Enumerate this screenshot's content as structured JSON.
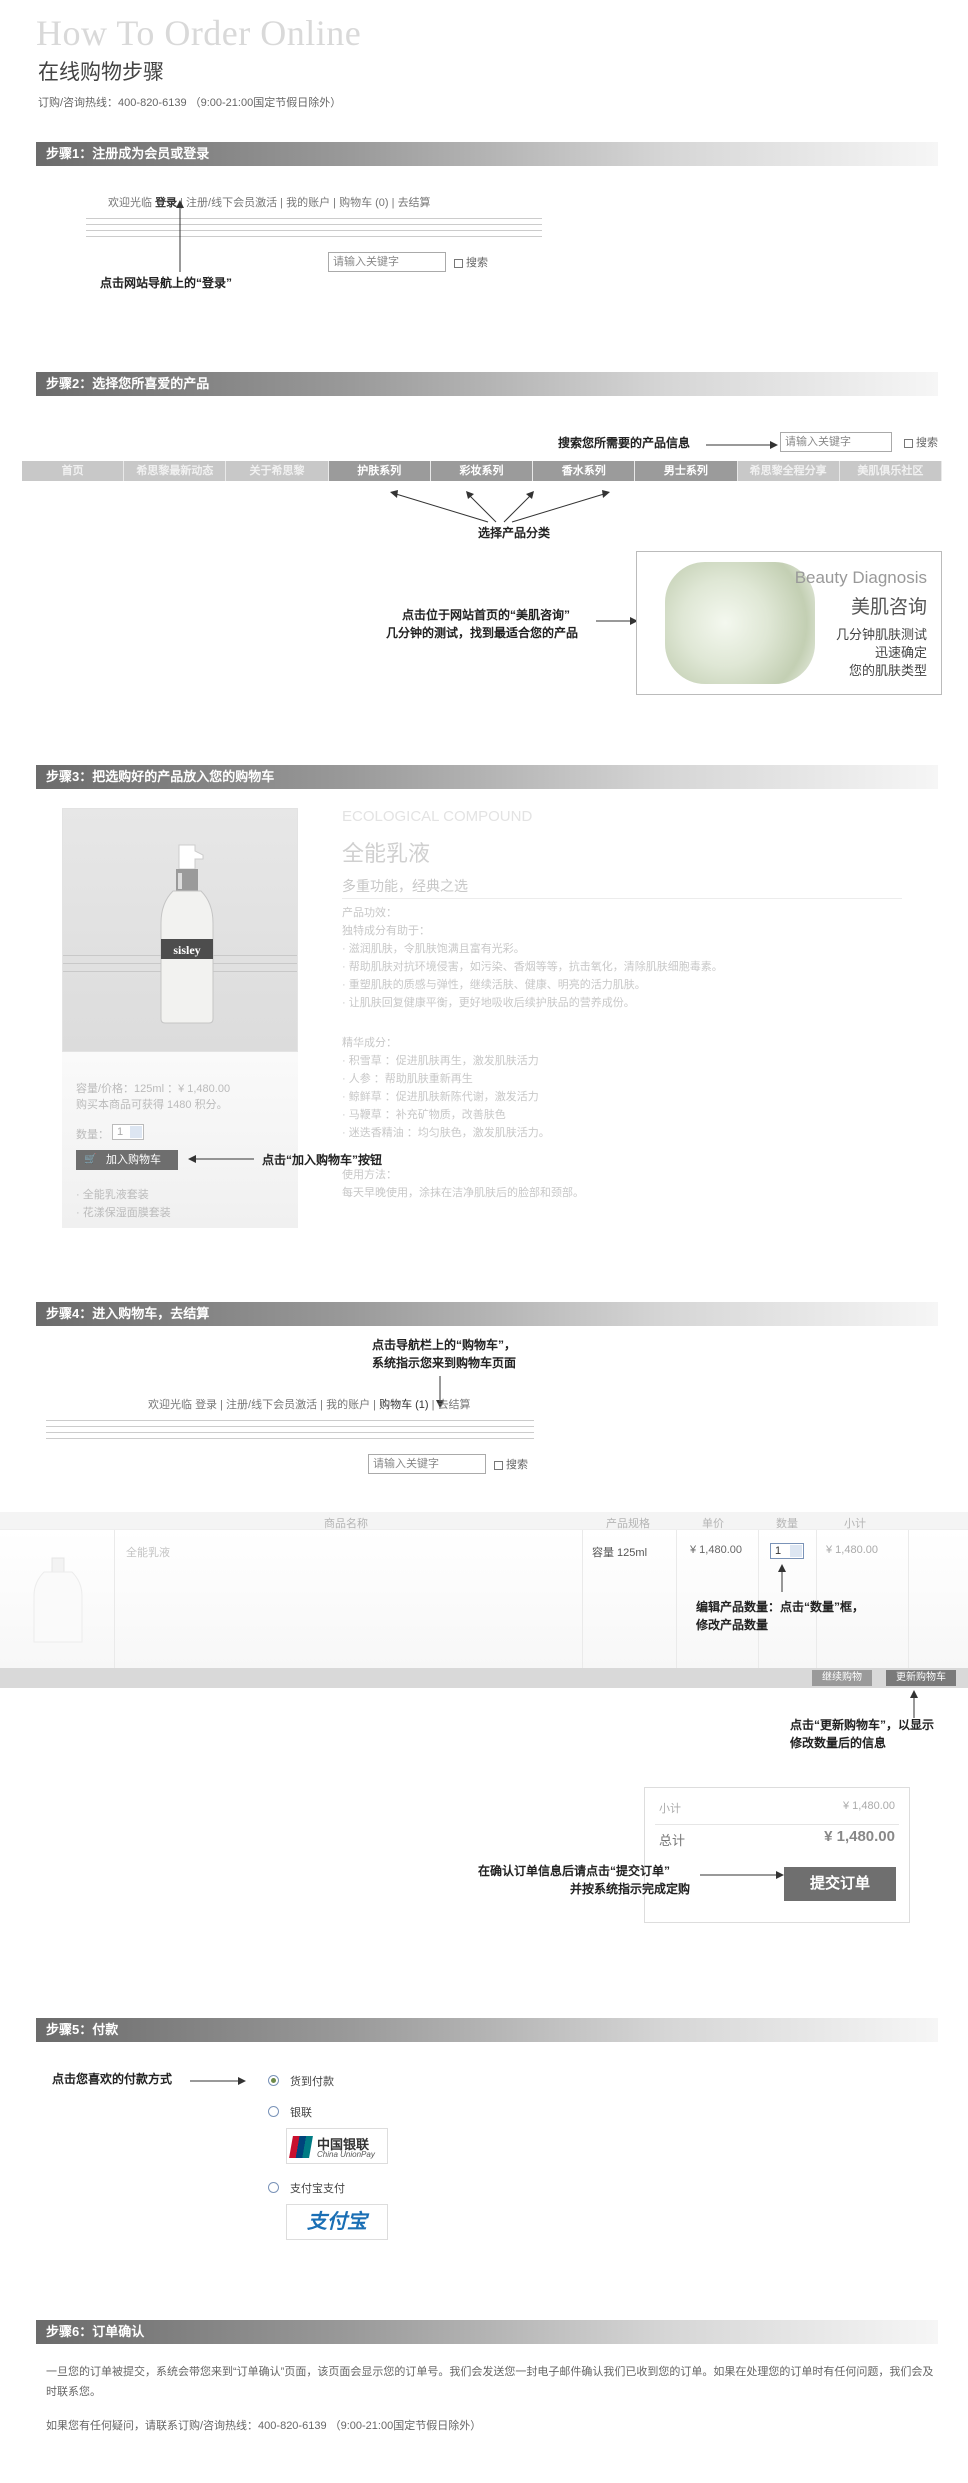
{
  "header": {
    "title_en": "How To Order Online",
    "title_cn": "在线购物步骤",
    "hotline": "订购/咨询热线：400-820-6139 （9:00-21:00国定节假日除外）"
  },
  "steps": [
    {
      "label": "步骤1：注册成为会员或登录"
    },
    {
      "label": "步骤2：选择您所喜爱的产品"
    },
    {
      "label": "步骤3：把选购好的产品放入您的购物车"
    },
    {
      "label": "步骤4：进入购物车，去结算"
    },
    {
      "label": "步骤5：付款"
    },
    {
      "label": "步骤6：订单确认"
    }
  ],
  "topnav1": {
    "welcome": "欢迎光临",
    "login": "登录",
    "sep": "|",
    "register": "注册/线下会员激活",
    "account": "我的账户",
    "cart": "购物车 (0)",
    "checkout": "去结算"
  },
  "topnav2": {
    "welcome": "欢迎光临",
    "login": "登录",
    "register": "注册/线下会员激活",
    "account": "我的账户",
    "cart": "购物车 (1)",
    "checkout": "去结算"
  },
  "search": {
    "placeholder": "请输入关键字",
    "button": "搜索"
  },
  "annotations": {
    "a1": "点击网站导航上的“登录”",
    "a2": "搜索您所需要的产品信息",
    "a3": "选择产品分类",
    "a4_1": "点击位于网站首页的“美肌咨询”",
    "a4_2": "几分钟的测试，找到最适合您的产品",
    "a5": "点击“加入购物车”按钮",
    "a6_1": "点击导航栏上的“购物车”，",
    "a6_2": "系统指示您来到购物车页面",
    "a7_1": "编辑产品数量：点击“数量”框，",
    "a7_2": "修改产品数量",
    "a8_1": "点击“更新购物车”，以显示",
    "a8_2": "修改数量后的信息",
    "a9_1": "在确认订单信息后请点击“提交订单”",
    "a9_2": "并按系统指示完成定购",
    "a10": "点击您喜欢的付款方式"
  },
  "mainnav": [
    "首页",
    "希思黎最新动态",
    "关于希思黎",
    "护肤系列",
    "彩妆系列",
    "香水系列",
    "男士系列",
    "希思黎全程分享",
    "美肌俱乐社区"
  ],
  "beauty": {
    "en": "Beauty Diagnosis",
    "cn": "美肌咨询",
    "l1": "几分钟肌肤测试",
    "l2": "迅速确定",
    "l3": "您的肌肤类型"
  },
  "product": {
    "eco": "ECOLOGICAL COMPOUND",
    "name": "全能乳液",
    "slogan": "多重功能，经典之选",
    "effect_h": "产品功效：",
    "effect_intro": "独特成分有助于：",
    "effects": [
      "· 滋润肌肤，令肌肤饱满且富有光彩。",
      "· 帮助肌肤对抗环境侵害，如污染、香烟等等，抗击氧化，清除肌肤细胞毒素。",
      "· 重塑肌肤的质感与弹性，继续活肤、健康、明亮的活力肌肤。",
      "· 让肌肤回复健康平衡，更好地吸收后续护肤品的营养成份。"
    ],
    "ingr_h": "精华成分：",
    "ingrs": [
      "· 积雪草 ：促进肌肤再生，激发肌肤活力",
      "· 人参 ：帮助肌肤重新再生",
      "· 鲸鲜草 ：促进肌肤新陈代谢，激发活力",
      "· 马鞭草 ：补充矿物质，改善肤色",
      "· 迷迭香精油 ：均匀肤色，激发肌肤活力。"
    ],
    "usage_h": "使用方法：",
    "usage": "每天早晚使用，涂抹在洁净肌肤后的脸部和颈部。",
    "spec": "容量/价格：125ml ：¥ 1,480.00",
    "points": "购买本商品可获得 1480 积分。",
    "qty_label": "数量：",
    "qty": "1",
    "add_cart": "加入购物车",
    "links": [
      "· 全能乳液套装",
      "· 花漾保湿面膜套装"
    ]
  },
  "cart": {
    "headers": [
      "商品名称",
      "产品规格",
      "单价",
      "数量",
      "小计"
    ],
    "item": "全能乳液",
    "spec": "容量  125ml",
    "price": "¥ 1,480.00",
    "qty": "1",
    "subtotal": "¥ 1,480.00",
    "continue_btn": "继续购物",
    "update_btn": "更新购物车",
    "sub_label": "小计",
    "sub_value": "¥ 1,480.00",
    "total_label": "总计",
    "total_value": "¥ 1,480.00",
    "submit": "提交订单"
  },
  "payment": {
    "cod": "货到付款",
    "unionpay": "银联",
    "unionpay_logo_cn": "中国银联",
    "unionpay_logo_en": "China UnionPay",
    "alipay": "支付宝支付",
    "alipay_logo": "支付宝"
  },
  "confirm": {
    "p1": "一旦您的订单被提交，系统会带您来到“订单确认”页面，该页面会显示您的订单号。我们会发送您一封电子邮件确认我们已收到您的订单。如果在处理您的订单时有任何问题，我们会及时联系您。",
    "p2": "如果您有任何疑问，请联系订购/咨询热线：400-820-6139 （9:00-21:00国定节假日除外）"
  }
}
